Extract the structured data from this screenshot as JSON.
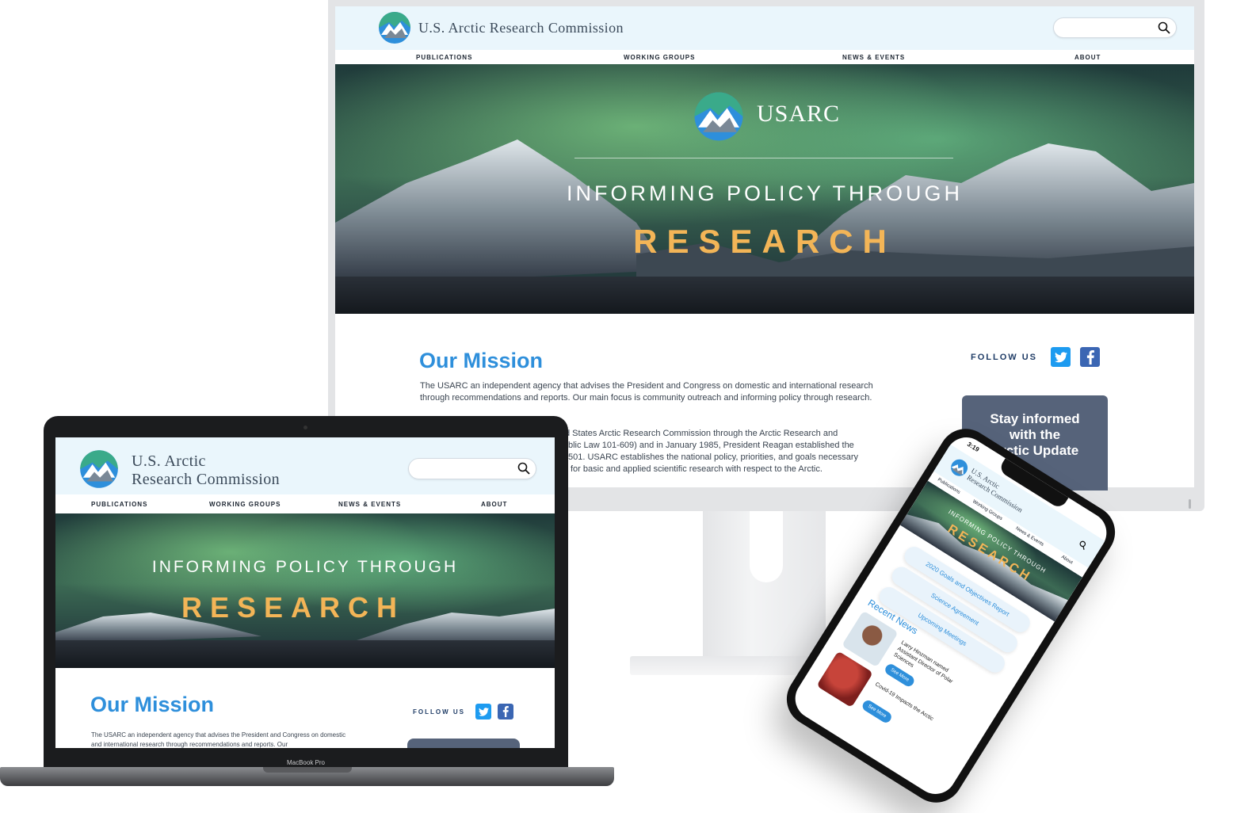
{
  "site": {
    "title": "U.S. Arctic Research Commission",
    "title_line1": "U.S. Arctic",
    "title_line2": "Research Commission",
    "acronym": "USARC"
  },
  "nav": {
    "publications": "PUBLICATIONS",
    "working_groups": "WORKING GROUPS",
    "news_events": "NEWS & EVENTS",
    "about": "ABOUT"
  },
  "hero": {
    "tagline": "INFORMING POLICY THROUGH",
    "highlight": "RESEARCH"
  },
  "mission": {
    "heading": "Our Mission",
    "p1": "The USARC an independent agency that advises the President and Congress on domestic and international research through recommendations and reports. Our main focus is community outreach and informing policy through research.",
    "p2_line1": "d States Arctic Research Commission through the Arctic Research and",
    "p2_line2": "blic Law 101-609) and in January 1985, President Reagan established the",
    "p2_line3": "501. USARC establishes the national policy, priorities, and goals necessary",
    "p2_line4": "for basic and applied scientific research with respect to the Arctic.",
    "laptop_p": "The USARC an independent agency that advises the President and Congress on domestic and international research through recommendations and reports. Our"
  },
  "social": {
    "follow_label": "FOLLOW US",
    "twitter_icon": "twitter-icon",
    "facebook_icon": "facebook-icon"
  },
  "newsletter": {
    "line1": "Stay informed",
    "line2": "with the",
    "line3": "Arctic Update"
  },
  "laptop": {
    "brand": "MacBook Pro"
  },
  "phone": {
    "time": "3:19",
    "nav": [
      "Publications",
      "Working Groups",
      "News & Events",
      "About"
    ],
    "links": [
      "2020 Goals and Objectives Report",
      "Science Agreement",
      "Upcoming Meetings"
    ],
    "recent_heading": "Recent News",
    "news": [
      {
        "title": "Larry Hinzman named Assistant Director of Polar Sciences",
        "button": "See More"
      },
      {
        "title": "Covid-19 Impacts the Arctic",
        "button": "See More"
      }
    ]
  },
  "colors": {
    "accent_blue": "#2e8fdb",
    "research_gold": "#f3b557",
    "header_bg": "#eaf6fc",
    "newsletter_bg": "#56637a"
  }
}
